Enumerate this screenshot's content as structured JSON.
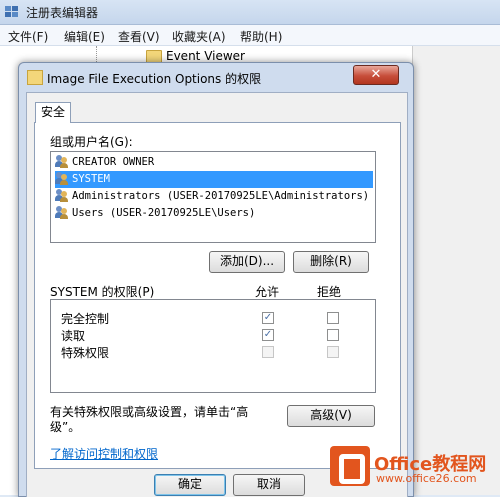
{
  "background_window": {
    "title": "注册表编辑器",
    "menu": [
      "文件(F)",
      "编辑(E)",
      "查看(V)",
      "收藏夹(A)",
      "帮助(H)"
    ],
    "tree_item": "Event Viewer"
  },
  "dialog": {
    "title": "Image File Execution Options 的权限",
    "close_label": "✕",
    "tab_label": "安全",
    "group_label": "组或用户名(G):",
    "users": [
      "CREATOR OWNER",
      "SYSTEM",
      "Administrators (USER-20170925LE\\Administrators)",
      "Users (USER-20170925LE\\Users)"
    ],
    "selected_user_index": 1,
    "add_button": "添加(D)...",
    "remove_button": "删除(R)",
    "permissions_label": "SYSTEM 的权限(P)",
    "allow_header": "允许",
    "deny_header": "拒绝",
    "permissions": [
      {
        "name": "完全控制",
        "allow": true,
        "deny": false,
        "disabled": false
      },
      {
        "name": "读取",
        "allow": true,
        "deny": false,
        "disabled": false
      },
      {
        "name": "特殊权限",
        "allow": false,
        "deny": false,
        "disabled": true
      }
    ],
    "advanced_text_line1": "有关特殊权限或高级设置，请单击“高",
    "advanced_text_line2": "级”。",
    "advanced_button": "高级(V)",
    "learn_link": "了解访问控制和权限",
    "ok_button": "确定",
    "cancel_button": "取消"
  },
  "watermark": {
    "brand": "Office教程网",
    "url": "www.office26.com"
  },
  "colors": {
    "selection": "#3399ff",
    "link": "#0066cc",
    "close_button": "#c74e3a"
  }
}
